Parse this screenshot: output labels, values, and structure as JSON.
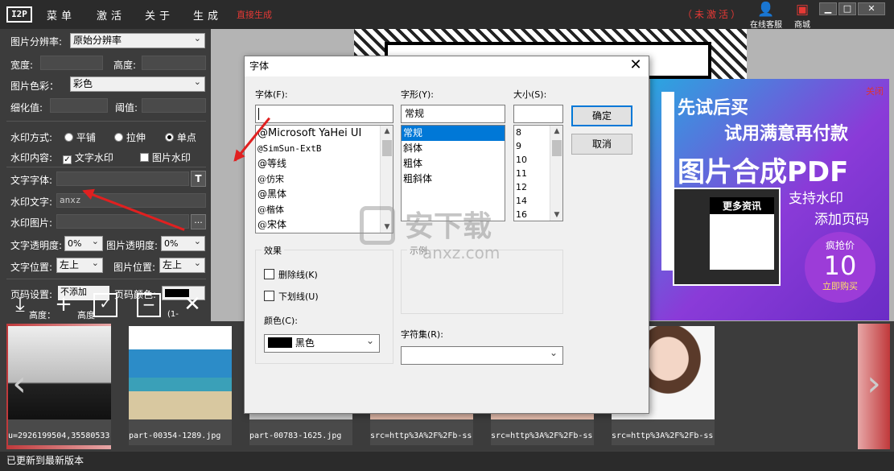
{
  "topbar": {
    "logo": "I2P",
    "menus": [
      "菜单",
      "激活",
      "关于",
      "生成"
    ],
    "generate_now": "直接生成",
    "trial": "（未激活）",
    "support_label": "在线客服",
    "shop_label": "商城",
    "window_buttons": [
      "minimize-icon",
      "maximize-icon",
      "close-icon"
    ]
  },
  "left": {
    "resolution_label": "图片分辨率:",
    "resolution_value": "原始分辨率",
    "width_label": "宽度:",
    "height_label": "高度:",
    "color_label": "图片色彩：",
    "color_value": "彩色",
    "thin_label": "细化值:",
    "threshold_label": "阈值:",
    "wm_mode_label": "水印方式:",
    "wm_modes": [
      "平铺",
      "拉伸",
      "单点"
    ],
    "wm_mode_selected": 2,
    "wm_content_label": "水印内容:",
    "wm_text_check": "文字水印",
    "wm_image_check": "图片水印",
    "text_font_label": "文字字体:",
    "font_button": "T",
    "wm_text_label": "水印文字:",
    "wm_text_value": "anxz",
    "wm_image_label": "水印图片:",
    "browse_button": "...",
    "text_opacity_label": "文字透明度:",
    "text_opacity_value": "0%",
    "image_opacity_label": "图片透明度:",
    "image_opacity_value": "0%",
    "text_pos_label": "文字位置:",
    "text_pos_value": "左上",
    "image_pos_label": "图片位置:",
    "image_pos_value": "左上",
    "page_setup_label": "页码设置:",
    "page_add_value": "不添加",
    "page_color_label": "页码颜色:",
    "partial_text": "高度：",
    "partial_text2": "高度",
    "partial_range": "(1-"
  },
  "ad": {
    "close": "关闭",
    "line1": "先试后买",
    "line2": "试用满意再付款",
    "line3": "图片合成PDF",
    "line4": "支持水印",
    "line5": "添加页码",
    "shot_caption": "更多资讯",
    "price_top": "疯抢价",
    "price": "10",
    "price_bottom": "立即购买"
  },
  "dialog": {
    "title": "字体",
    "font_label": "字体(F):",
    "font_value": "",
    "fonts": [
      "@Microsoft YaHei UI",
      "@SimSun-ExtB",
      "@等线",
      "@仿宋",
      "@黑体",
      "@楷体",
      "@宋体"
    ],
    "style_label": "字形(Y):",
    "style_value": "常规",
    "styles": [
      "常规",
      "斜体",
      "粗体",
      "粗斜体"
    ],
    "size_label": "大小(S):",
    "size_value": "",
    "sizes": [
      "8",
      "9",
      "10",
      "11",
      "12",
      "14",
      "16"
    ],
    "ok": "确定",
    "cancel": "取消",
    "effects_label": "效果",
    "strikeout": "删除线(K)",
    "underline": "下划线(U)",
    "color_label": "颜色(C):",
    "color_value": "黑色",
    "sample_label": "示例",
    "charset_label": "字符集(R):",
    "charset_value": ""
  },
  "thumbs": [
    {
      "caption": "u=2926199504,35580533"
    },
    {
      "caption": "part-00354-1289.jpg"
    },
    {
      "caption": "part-00783-1625.jpg"
    },
    {
      "caption": "src=http%3A%2F%2Fb-ss"
    },
    {
      "caption": "src=http%3A%2F%2Fb-ss"
    },
    {
      "caption": "src=http%3A%2F%2Fb-ss"
    }
  ],
  "watermark": {
    "cn": "安下载",
    "en": "anxz.com"
  },
  "status": "已更新到最新版本",
  "colors": {
    "accent": "#0078d7",
    "trial_red": "#e53935",
    "arrow_red": "#e02020"
  }
}
